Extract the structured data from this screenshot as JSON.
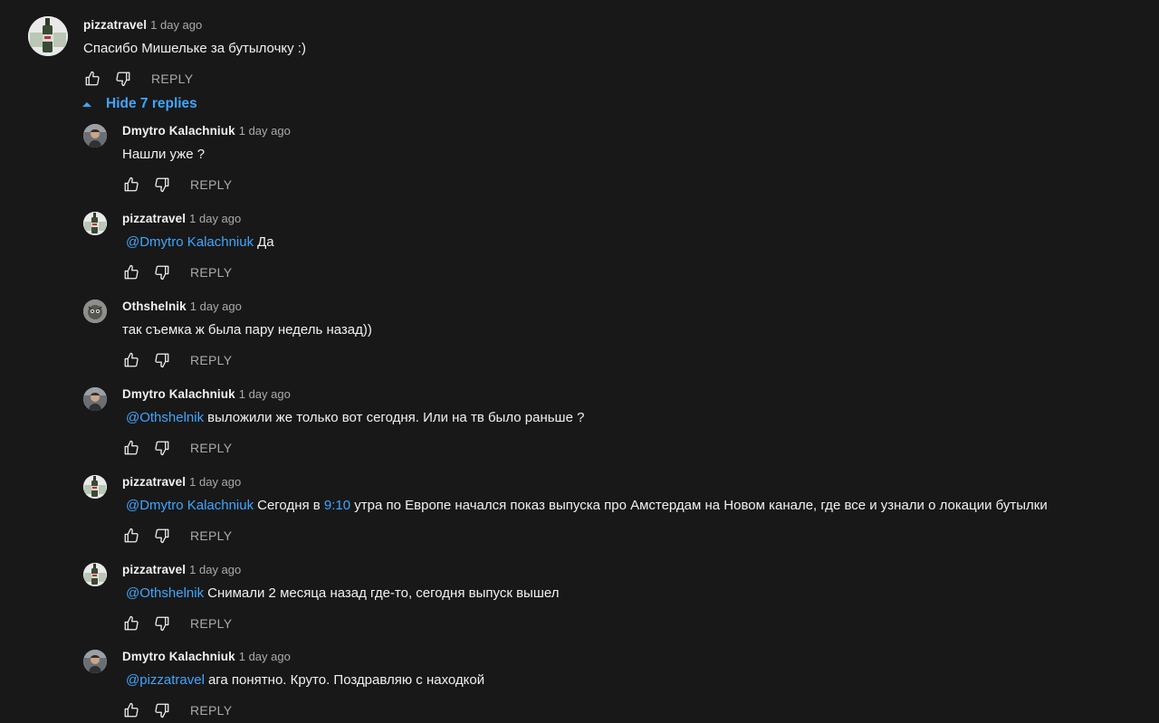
{
  "top_comment": {
    "author": "pizzatravel",
    "time": "1 day ago",
    "text": "Спасибо Мишельке за бутылочку :)",
    "reply_label": "REPLY",
    "hide_replies_label": "Hide 7 replies"
  },
  "replies": [
    {
      "author": "Dmytro Kalachniuk",
      "time": "1 day ago",
      "mention": "",
      "text": "Нашли уже ?",
      "reply_label": "REPLY",
      "avatar": "dmytro"
    },
    {
      "author": "pizzatravel",
      "time": "1 day ago",
      "mention": "@Dmytro Kalachniuk",
      "text": "Да",
      "reply_label": "REPLY",
      "avatar": "pizza"
    },
    {
      "author": "Othshelnik",
      "time": "1 day ago",
      "mention": "",
      "text": "так съемка ж была пару недель назад))",
      "reply_label": "REPLY",
      "avatar": "oths"
    },
    {
      "author": "Dmytro Kalachniuk",
      "time": "1 day ago",
      "mention": "@Othshelnik",
      "text": "выложили же только вот сегодня. Или на тв было раньше ?",
      "reply_label": "REPLY",
      "avatar": "dmytro"
    },
    {
      "author": "pizzatravel",
      "time": "1 day ago",
      "mention": "@Dmytro Kalachniuk",
      "text_before": "Сегодня в ",
      "timestamp_link": "9:10",
      "text_after": " утра по Европе начался показ выпуска про Амстердам на Новом канале, где все и узнали о локации бутылки",
      "reply_label": "REPLY",
      "avatar": "pizza"
    },
    {
      "author": "pizzatravel",
      "time": "1 day ago",
      "mention": "@Othshelnik",
      "text": "Снимали 2 месяца назад где-то, сегодня выпуск вышел",
      "reply_label": "REPLY",
      "avatar": "pizza"
    },
    {
      "author": "Dmytro Kalachniuk",
      "time": "1 day ago",
      "mention": "@pizzatravel",
      "text": "ага понятно. Круто. Поздравляю с находкой",
      "reply_label": "REPLY",
      "avatar": "dmytro"
    }
  ],
  "icons": {
    "like": "thumb-up-icon",
    "dislike": "thumb-down-icon",
    "hide": "caret-up-icon"
  },
  "colors": {
    "background": "#181818",
    "link": "#3ea6ff",
    "secondary_text": "#aaaaaa",
    "primary_text": "#f1f1f1"
  }
}
